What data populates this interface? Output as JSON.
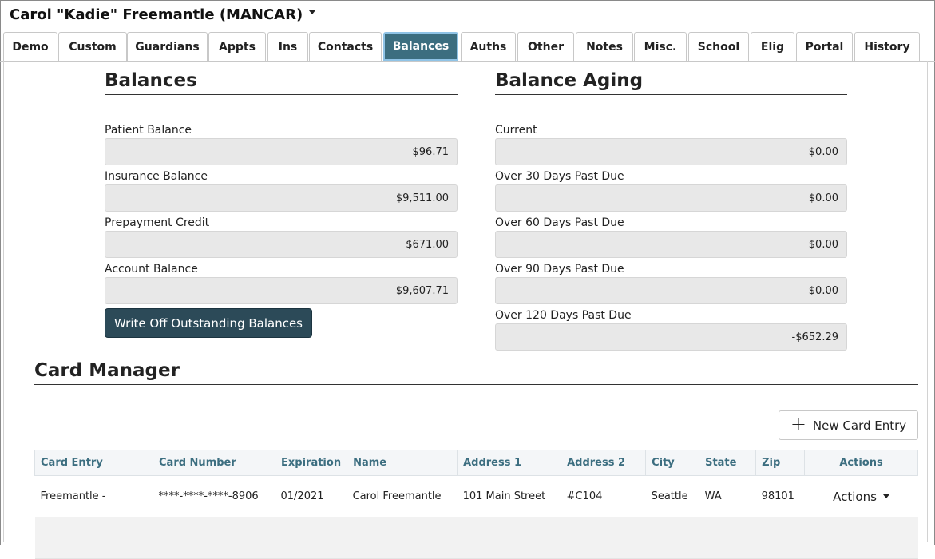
{
  "header": {
    "patient_name": "Carol \"Kadie\" Freemantle (MANCAR)"
  },
  "tabs": [
    {
      "label": "Demo"
    },
    {
      "label": "Custom"
    },
    {
      "label": "Guardians"
    },
    {
      "label": "Appts"
    },
    {
      "label": "Ins"
    },
    {
      "label": "Contacts"
    },
    {
      "label": "Balances"
    },
    {
      "label": "Auths"
    },
    {
      "label": "Other"
    },
    {
      "label": "Notes"
    },
    {
      "label": "Misc."
    },
    {
      "label": "School"
    },
    {
      "label": "Elig"
    },
    {
      "label": "Portal"
    },
    {
      "label": "History"
    }
  ],
  "active_tab": "Balances",
  "balances": {
    "title": "Balances",
    "patient_label": "Patient Balance",
    "patient_value": "$96.71",
    "insurance_label": "Insurance Balance",
    "insurance_value": "$9,511.00",
    "prepay_label": "Prepayment Credit",
    "prepay_value": "$671.00",
    "account_label": "Account Balance",
    "account_value": "$9,607.71",
    "writeoff_label": "Write Off Outstanding Balances"
  },
  "aging": {
    "title": "Balance Aging",
    "current_label": "Current",
    "current_value": "$0.00",
    "over30_label": "Over 30 Days Past Due",
    "over30_value": "$0.00",
    "over60_label": "Over 60 Days Past Due",
    "over60_value": "$0.00",
    "over90_label": "Over 90 Days Past Due",
    "over90_value": "$0.00",
    "over120_label": "Over 120 Days Past Due",
    "over120_value": "-$652.29"
  },
  "card_manager": {
    "title": "Card Manager",
    "new_entry_label": "New Card Entry",
    "columns": [
      "Card Entry",
      "Card Number",
      "Expiration",
      "Name",
      "Address 1",
      "Address 2",
      "City",
      "State",
      "Zip",
      "Actions"
    ],
    "rows": [
      {
        "card_entry": "Freemantle -",
        "card_number": "****-****-****-8906",
        "expiration": "01/2021",
        "name": "Carol Freemantle",
        "address1": "101 Main Street",
        "address2": "#C104",
        "city": "Seattle",
        "state": "WA",
        "zip": "98101",
        "actions": "Actions"
      }
    ]
  },
  "colors": {
    "active_tab": "#3c6e80",
    "button_dark": "#2c4a58",
    "header_text": "#3c6e80"
  }
}
